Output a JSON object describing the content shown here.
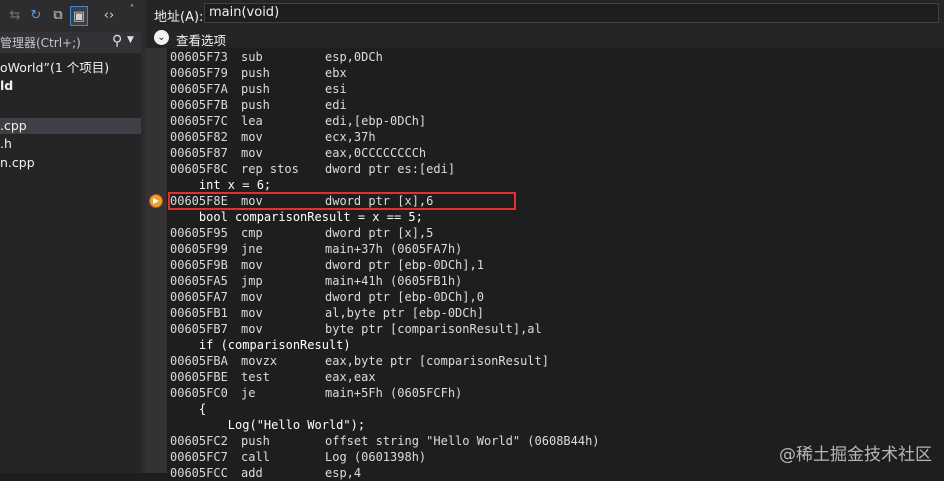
{
  "left_panel": {
    "search_placeholder": "管理器(Ctrl+;)",
    "tree": [
      {
        "label": "oWorld”(1 个项目)",
        "bold": false,
        "selected": false
      },
      {
        "label": "ld",
        "bold": true,
        "selected": false
      },
      {
        "label": ".cpp",
        "bold": false,
        "selected": true
      },
      {
        "label": ".h",
        "bold": false,
        "selected": false
      },
      {
        "label": "n.cpp",
        "bold": false,
        "selected": false
      }
    ]
  },
  "address_bar": {
    "label": "地址(A):",
    "value": "main(void)"
  },
  "view_options": {
    "label": "查看选项"
  },
  "disassembly": [
    {
      "kind": "asm",
      "addr": "00605F73",
      "mn": "sub",
      "op": "esp,0DCh"
    },
    {
      "kind": "asm",
      "addr": "00605F79",
      "mn": "push",
      "op": "ebx"
    },
    {
      "kind": "asm",
      "addr": "00605F7A",
      "mn": "push",
      "op": "esi"
    },
    {
      "kind": "asm",
      "addr": "00605F7B",
      "mn": "push",
      "op": "edi"
    },
    {
      "kind": "asm",
      "addr": "00605F7C",
      "mn": "lea",
      "op": "edi,[ebp-0DCh]"
    },
    {
      "kind": "asm",
      "addr": "00605F82",
      "mn": "mov",
      "op": "ecx,37h"
    },
    {
      "kind": "asm",
      "addr": "00605F87",
      "mn": "mov",
      "op": "eax,0CCCCCCCCh"
    },
    {
      "kind": "asm",
      "addr": "00605F8C",
      "mn": "rep stos",
      "op": "dword ptr es:[edi]"
    },
    {
      "kind": "src",
      "text": "    int x = 6;"
    },
    {
      "kind": "asm",
      "addr": "00605F8E",
      "mn": "mov",
      "op": "dword ptr [x],6",
      "current": true
    },
    {
      "kind": "src",
      "text": "    bool comparisonResult = x == 5;"
    },
    {
      "kind": "asm",
      "addr": "00605F95",
      "mn": "cmp",
      "op": "dword ptr [x],5"
    },
    {
      "kind": "asm",
      "addr": "00605F99",
      "mn": "jne",
      "op": "main+37h (0605FA7h)"
    },
    {
      "kind": "asm",
      "addr": "00605F9B",
      "mn": "mov",
      "op": "dword ptr [ebp-0DCh],1"
    },
    {
      "kind": "asm",
      "addr": "00605FA5",
      "mn": "jmp",
      "op": "main+41h (0605FB1h)"
    },
    {
      "kind": "asm",
      "addr": "00605FA7",
      "mn": "mov",
      "op": "dword ptr [ebp-0DCh],0"
    },
    {
      "kind": "asm",
      "addr": "00605FB1",
      "mn": "mov",
      "op": "al,byte ptr [ebp-0DCh]"
    },
    {
      "kind": "asm",
      "addr": "00605FB7",
      "mn": "mov",
      "op": "byte ptr [comparisonResult],al"
    },
    {
      "kind": "src",
      "text": "    if (comparisonResult)"
    },
    {
      "kind": "asm",
      "addr": "00605FBA",
      "mn": "movzx",
      "op": "eax,byte ptr [comparisonResult]"
    },
    {
      "kind": "asm",
      "addr": "00605FBE",
      "mn": "test",
      "op": "eax,eax"
    },
    {
      "kind": "asm",
      "addr": "00605FC0",
      "mn": "je",
      "op": "main+5Fh (0605FCFh)"
    },
    {
      "kind": "src",
      "text": "    {"
    },
    {
      "kind": "src",
      "text": "        Log(\"Hello World\");"
    },
    {
      "kind": "asm",
      "addr": "00605FC2",
      "mn": "push",
      "op": "offset string \"Hello World\" (0608B44h)"
    },
    {
      "kind": "asm",
      "addr": "00605FC7",
      "mn": "call",
      "op": "Log (0601398h)"
    },
    {
      "kind": "asm",
      "addr": "00605FCC",
      "mn": "add",
      "op": "esp,4"
    }
  ],
  "watermark": "@稀土掘金技术社区",
  "icons": [
    "back-icon",
    "refresh-icon",
    "collapse-icon",
    "show-all-files-icon",
    "code-view-icon",
    "search-icon",
    "expand-icon",
    "execution-pointer-icon"
  ],
  "colors": {
    "highlight_box": "#e03030",
    "execution_pointer": "#e8a033"
  }
}
